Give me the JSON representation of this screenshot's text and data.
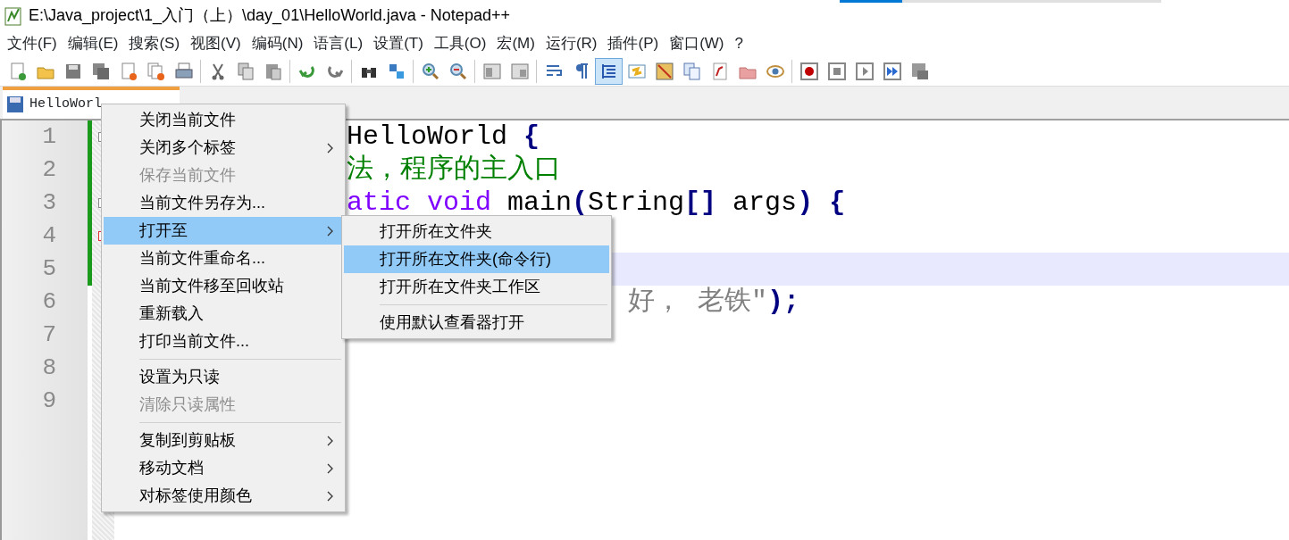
{
  "window": {
    "title": "E:\\Java_project\\1_入门（上）\\day_01\\HelloWorld.java - Notepad++"
  },
  "menu_bar": [
    "文件(F)",
    "编辑(E)",
    "搜索(S)",
    "视图(V)",
    "编码(N)",
    "语言(L)",
    "设置(T)",
    "工具(O)",
    "宏(M)",
    "运行(R)",
    "插件(P)",
    "窗口(W)",
    "?"
  ],
  "toolbar": [
    [
      {
        "pressed": false
      },
      {
        "pressed": false
      },
      {
        "pressed": false
      },
      {
        "pressed": false
      },
      {
        "pressed": false
      },
      {
        "pressed": false
      },
      {
        "pressed": false
      }
    ],
    [
      {
        "pressed": false
      },
      {
        "pressed": false
      },
      {
        "pressed": false
      }
    ],
    [
      {
        "pressed": false
      },
      {
        "pressed": false
      }
    ],
    [
      {
        "pressed": false
      },
      {
        "pressed": false
      }
    ],
    [
      {
        "pressed": false
      },
      {
        "pressed": false
      }
    ],
    [
      {
        "pressed": false
      },
      {
        "pressed": false
      }
    ],
    [
      {
        "pressed": false
      },
      {
        "pressed": false
      },
      {
        "pressed": true
      },
      {
        "pressed": false
      },
      {
        "pressed": false
      },
      {
        "pressed": false
      },
      {
        "pressed": false
      },
      {
        "pressed": false
      },
      {
        "pressed": false
      }
    ],
    [
      {
        "pressed": false
      },
      {
        "pressed": false
      },
      {
        "pressed": false
      },
      {
        "pressed": false
      },
      {
        "pressed": false
      }
    ]
  ],
  "tabs": [
    {
      "label": "HelloWorl",
      "selected": true
    }
  ],
  "editor": {
    "lines": [
      {
        "number": "1",
        "current": false,
        "segments": [
          {
            "text": "HelloWorld ",
            "kind": "plain"
          },
          {
            "text": "{",
            "kind": "operator"
          }
        ]
      },
      {
        "number": "2",
        "current": false,
        "segments": [
          {
            "text": "法，程序的主入口",
            "kind": "comment"
          }
        ]
      },
      {
        "number": "3",
        "current": false,
        "segments": [
          {
            "text": "atic void",
            "kind": "keyword"
          },
          {
            "text": " main",
            "kind": "plain"
          },
          {
            "text": "(",
            "kind": "operator"
          },
          {
            "text": "String",
            "kind": "plain"
          },
          {
            "text": "[]",
            "kind": "operator"
          },
          {
            "text": " args",
            "kind": "plain"
          },
          {
            "text": ") {",
            "kind": "operator"
          }
        ]
      },
      {
        "number": "4",
        "current": false
      },
      {
        "number": "5",
        "current": true
      },
      {
        "number": "6",
        "current": false,
        "segments": [
          {
            "text": "好， 老铁\"",
            "kind": "string"
          },
          {
            "text": ");",
            "kind": "operator"
          }
        ]
      },
      {
        "number": "7",
        "current": false
      },
      {
        "number": "8",
        "current": false
      },
      {
        "number": "9",
        "current": false
      }
    ]
  },
  "context_menu": {
    "items": [
      {
        "kind": "item",
        "label": "关闭当前文件",
        "disabled": false,
        "submenu": false,
        "selected": false
      },
      {
        "kind": "item",
        "label": "关闭多个标签",
        "disabled": false,
        "submenu": true,
        "selected": false
      },
      {
        "kind": "item",
        "label": "保存当前文件",
        "disabled": true,
        "submenu": false,
        "selected": false
      },
      {
        "kind": "item",
        "label": "当前文件另存为...",
        "disabled": false,
        "submenu": false,
        "selected": false
      },
      {
        "kind": "item",
        "label": "打开至",
        "disabled": false,
        "submenu": true,
        "selected": true
      },
      {
        "kind": "item",
        "label": "当前文件重命名...",
        "disabled": false,
        "submenu": false,
        "selected": false
      },
      {
        "kind": "item",
        "label": "当前文件移至回收站",
        "disabled": false,
        "submenu": false,
        "selected": false
      },
      {
        "kind": "item",
        "label": "重新载入",
        "disabled": false,
        "submenu": false,
        "selected": false
      },
      {
        "kind": "item",
        "label": "打印当前文件...",
        "disabled": false,
        "submenu": false,
        "selected": false
      },
      {
        "kind": "separator"
      },
      {
        "kind": "item",
        "label": "设置为只读",
        "disabled": false,
        "submenu": false,
        "selected": false
      },
      {
        "kind": "item",
        "label": "清除只读属性",
        "disabled": true,
        "submenu": false,
        "selected": false
      },
      {
        "kind": "separator"
      },
      {
        "kind": "item",
        "label": "复制到剪贴板",
        "disabled": false,
        "submenu": true,
        "selected": false
      },
      {
        "kind": "item",
        "label": "移动文档",
        "disabled": false,
        "submenu": true,
        "selected": false
      },
      {
        "kind": "item",
        "label": "对标签使用颜色",
        "disabled": false,
        "submenu": true,
        "selected": false
      }
    ]
  },
  "submenu": {
    "items": [
      {
        "kind": "item",
        "label": "打开所在文件夹",
        "disabled": false,
        "selected": false
      },
      {
        "kind": "item",
        "label": "打开所在文件夹(命令行)",
        "disabled": false,
        "selected": true
      },
      {
        "kind": "item",
        "label": "打开所在文件夹工作区",
        "disabled": false,
        "selected": false
      },
      {
        "kind": "separator"
      },
      {
        "kind": "item",
        "label": "使用默认查看器打开",
        "disabled": false,
        "selected": false
      }
    ]
  }
}
